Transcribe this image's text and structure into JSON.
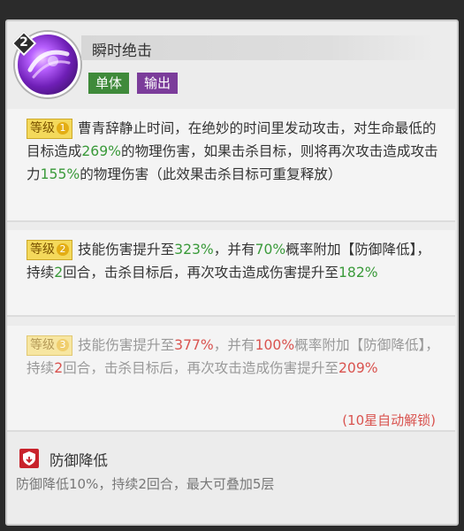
{
  "skill": {
    "level_badge": "2",
    "title": "瞬时绝击",
    "tags": [
      "单体",
      "输出"
    ]
  },
  "levels": [
    {
      "label": "等级",
      "num": "1",
      "parts": [
        {
          "t": "曹青辞静止时间，在绝妙的时间里发动攻击，对生命最低的目标造成"
        },
        {
          "t": "269%",
          "c": "g"
        },
        {
          "t": "的物理伤害，如果击杀目标，则将再次攻击造成攻击力"
        },
        {
          "t": "155%",
          "c": "g"
        },
        {
          "t": "的物理伤害（此效果击杀目标可重复释放）"
        }
      ]
    },
    {
      "label": "等级",
      "num": "2",
      "parts": [
        {
          "t": "技能伤害提升至"
        },
        {
          "t": "323%",
          "c": "g"
        },
        {
          "t": "，并有"
        },
        {
          "t": "70%",
          "c": "g"
        },
        {
          "t": "概率附加【防御降低】，持续"
        },
        {
          "t": "2",
          "c": "g"
        },
        {
          "t": "回合，击杀目标后，再次攻击造成伤害提升至"
        },
        {
          "t": "182%",
          "c": "g"
        }
      ]
    },
    {
      "label": "等级",
      "num": "3",
      "parts": [
        {
          "t": "技能伤害提升至"
        },
        {
          "t": "377%",
          "c": "r"
        },
        {
          "t": "，并有"
        },
        {
          "t": "100%",
          "c": "r"
        },
        {
          "t": "概率附加【防御降低】，持续"
        },
        {
          "t": "2",
          "c": "r"
        },
        {
          "t": "回合，击杀目标后，再次攻击造成伤害提升至"
        },
        {
          "t": "209%",
          "c": "r"
        }
      ]
    }
  ],
  "unlock_note": "(10星自动解锁)",
  "effect": {
    "icon": "shield-down-icon",
    "title": "防御降低",
    "desc": "防御降低10%，持续2回合，最大可叠加5层"
  },
  "colors": {
    "green": "#3a9a3a",
    "red": "#d9534f",
    "tag_green": "#3f8a3a",
    "tag_purple": "#7b3c9a"
  }
}
